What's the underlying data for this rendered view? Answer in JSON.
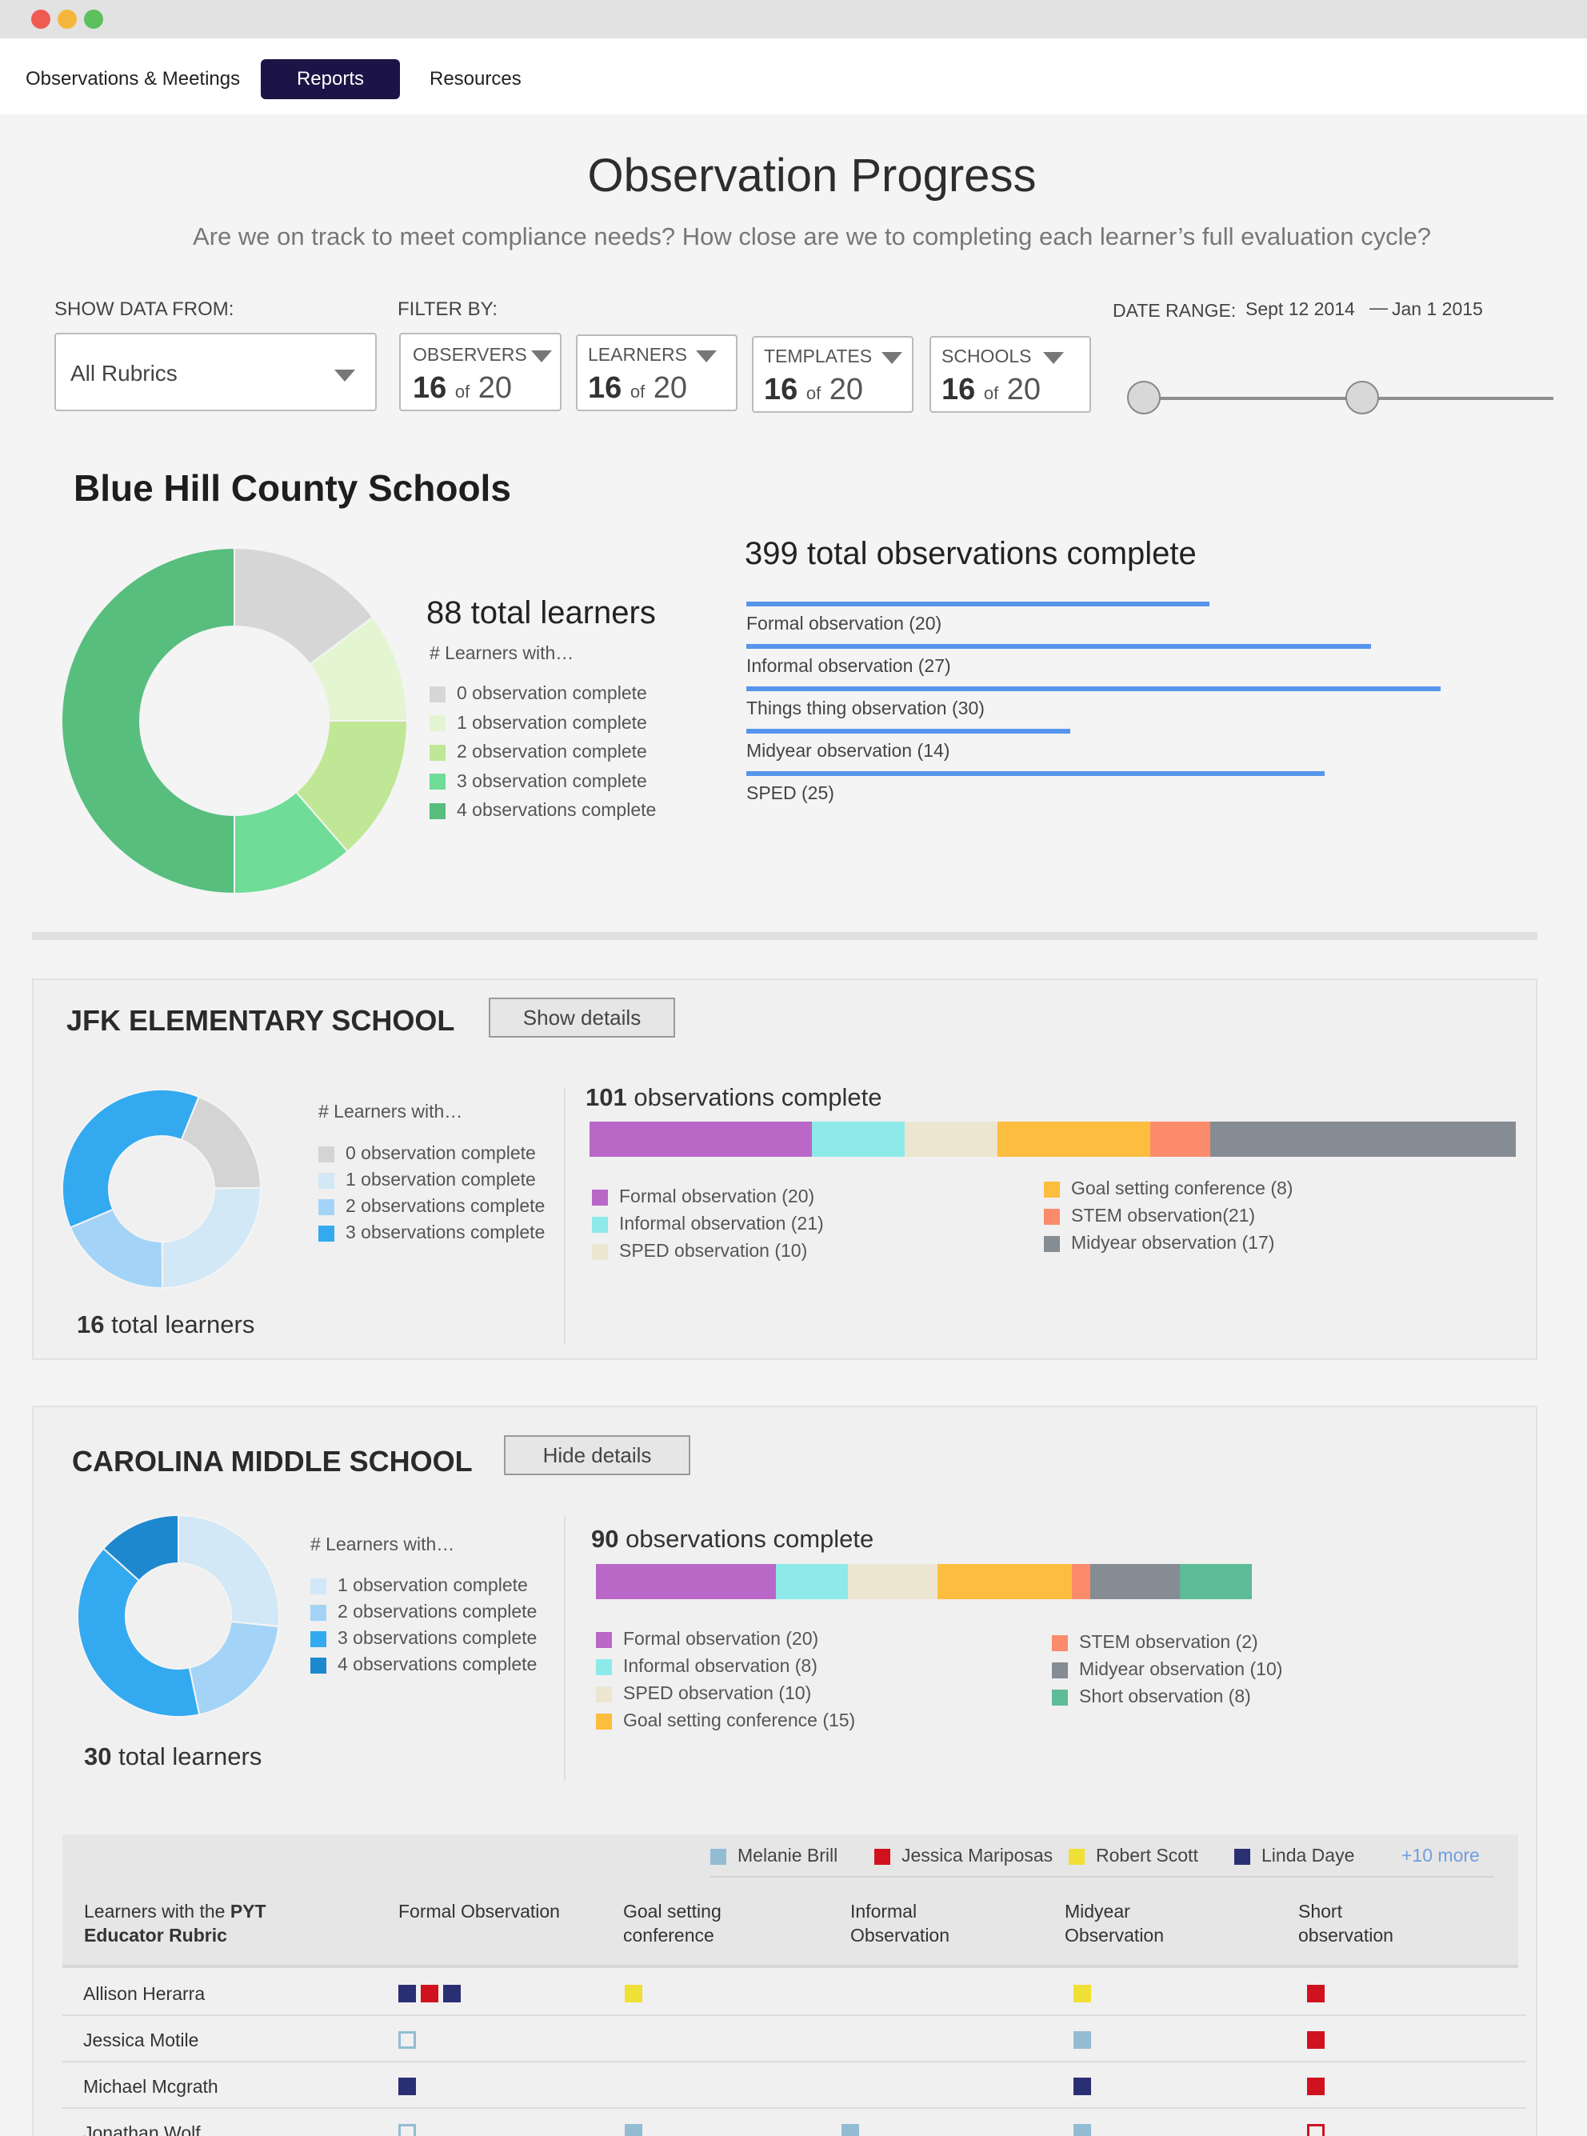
{
  "window": {
    "controls": [
      "close-icon",
      "minimize-icon",
      "zoom-icon"
    ],
    "control_colors": [
      "#ef5a52",
      "#f5b73b",
      "#5cc05f"
    ]
  },
  "nav": {
    "items": [
      "Observations & Meetings",
      "Reports",
      "Resources"
    ],
    "active": "Reports"
  },
  "page": {
    "title": "Observation Progress",
    "subtitle": "Are we on track to meet compliance needs? How close are we to completing each learner’s full evaluation cycle?"
  },
  "filters": {
    "show_label": "SHOW DATA FROM:",
    "rubric_value": "All Rubrics",
    "filter_label": "FILTER BY:",
    "observers": {
      "label": "OBSERVERS",
      "selected": "16",
      "of": "of",
      "total": "20"
    },
    "learners": {
      "label": "LEARNERS",
      "selected": "16",
      "of": "of",
      "total": "20"
    },
    "templates": {
      "label": "TEMPLATES",
      "selected": "16",
      "of": "of",
      "total": "20"
    },
    "schools": {
      "label": "SCHOOLS",
      "selected": "16",
      "of": "of",
      "total": "20"
    },
    "date_label": "DATE RANGE:",
    "date_start": "Sept 12 2014",
    "date_sep": "—",
    "date_end": "Jan 1 2015",
    "range_start_fraction": 0,
    "range_end_fraction": 0.55
  },
  "district": {
    "name": "Blue Hill County Schools",
    "learners_total": "88 total learners",
    "learners_caption": "# Learners with…",
    "observations_total": "399 total observations complete"
  },
  "jfk": {
    "name": "JFK ELEMENTARY SCHOOL",
    "button": "Show details",
    "caption": "# Learners with…",
    "learners_count": "16",
    "learners_suffix": "total learners",
    "obs_count": "101",
    "obs_suffix": "observations complete"
  },
  "carolina": {
    "name": "CAROLINA MIDDLE SCHOOL",
    "button": "Hide details",
    "caption": "# Learners with…",
    "learners_count": "30",
    "learners_suffix": "total learners",
    "obs_count": "90",
    "obs_suffix": "observations complete"
  },
  "table": {
    "observers": [
      {
        "name": "Melanie Brill",
        "color": "#93bcd3"
      },
      {
        "name": "Jessica Mariposas",
        "color": "#d0121f"
      },
      {
        "name": "Robert Scott",
        "color": "#f0e035"
      },
      {
        "name": "Linda Daye",
        "color": "#2a2f74"
      }
    ],
    "more": "+10 more",
    "learner_col_prefix": "Learners with the ",
    "learner_col_bold": "PYT",
    "learner_col_line2": "Educator Rubric",
    "columns": [
      [
        "Formal Observation",
        ""
      ],
      [
        "Goal setting",
        "conference"
      ],
      [
        "Informal",
        "Observation"
      ],
      [
        "Midyear",
        "Observation"
      ],
      [
        "Short",
        "observation"
      ]
    ],
    "rows": [
      "Allison Herarra",
      "Jessica Motile",
      "Michael Mcgrath",
      "Jonathan Wolf"
    ]
  },
  "chart_data": [
    {
      "type": "pie",
      "chart": "district-learners-donut",
      "labels": [
        "0 observation complete",
        "1 observation complete",
        "2 observation complete",
        "3 observation complete",
        "4 observations complete"
      ],
      "values": [
        13,
        9,
        12,
        10,
        44
      ],
      "colors": [
        "#d6d6d6",
        "#e4f5d2",
        "#c0e795",
        "#6fdc98",
        "#57be7e"
      ]
    },
    {
      "type": "bar",
      "chart": "district-observation-bars",
      "categories": [
        "Formal observation (20)",
        "Informal observation (27)",
        "Things thing observation (30)",
        "Midyear observation (14)",
        "SPED (25)"
      ],
      "values": [
        20,
        27,
        30,
        14,
        25
      ],
      "color": "#5795ec"
    },
    {
      "type": "pie",
      "chart": "jfk-learners-donut",
      "labels": [
        "0 observation complete",
        "1 observation complete",
        "2 observations complete",
        "3 observations complete"
      ],
      "values": [
        3,
        4,
        3,
        6
      ],
      "colors": [
        "#d4d4d4",
        "#d3e8f6",
        "#a3d4f7",
        "#33aaf0"
      ]
    },
    {
      "type": "bar",
      "chart": "jfk-observation-stack",
      "categories": [
        "Formal observation (20)",
        "Informal observation (21)",
        "SPED observation (10)",
        "Goal setting conference (8)",
        "STEM observation(21)",
        "Midyear observation (17)"
      ],
      "values": [
        20,
        21,
        10,
        8,
        21,
        17
      ],
      "segments": [
        24,
        10,
        10,
        16.5,
        6.5,
        33
      ],
      "segment_colors": [
        "#b968c7",
        "#8eeae8",
        "#ece6d1",
        "#fdbd3e",
        "#fb8b6b",
        "#858c94"
      ],
      "legend_order": [
        0,
        1,
        2,
        3,
        4,
        5
      ]
    },
    {
      "type": "pie",
      "chart": "carolina-learners-donut",
      "labels": [
        "1 observation complete",
        "2 observations complete",
        "3 observations complete",
        "4 observations complete"
      ],
      "values": [
        8,
        6,
        12,
        4
      ],
      "colors": [
        "#d3e8f6",
        "#a3d4f7",
        "#33aaf0",
        "#1e88ce"
      ]
    },
    {
      "type": "bar",
      "chart": "carolina-observation-stack",
      "categories": [
        "Formal observation (20)",
        "Informal observation (8)",
        "SPED observation (10)",
        "Goal setting conference (15)",
        "STEM observation (2)",
        "Midyear observation (10)",
        "Short observation (8)"
      ],
      "values": [
        20,
        8,
        10,
        15,
        2,
        10,
        8
      ],
      "segment_colors": [
        "#b968c7",
        "#8eeae8",
        "#ece6d1",
        "#fdbd3e",
        "#fb8b6b",
        "#858c94",
        "#5ebb97"
      ]
    }
  ],
  "grid": {
    "rows": [
      [
        [
          [
            "f",
            "#2a2f74"
          ],
          [
            "f",
            "#d0121f"
          ],
          [
            "f",
            "#2a2f74"
          ]
        ],
        [
          [
            "f",
            "#f0e035"
          ]
        ],
        [],
        [
          [
            "f",
            "#f0e035"
          ]
        ],
        [
          [
            "f",
            "#d0121f"
          ]
        ]
      ],
      [
        [
          [
            "o",
            "#93bcd3"
          ]
        ],
        [],
        [],
        [
          [
            "f",
            "#93bcd3"
          ]
        ],
        [
          [
            "f",
            "#d0121f"
          ]
        ]
      ],
      [
        [
          [
            "f",
            "#2a2f74"
          ]
        ],
        [],
        [],
        [
          [
            "f",
            "#2a2f74"
          ]
        ],
        [
          [
            "f",
            "#d0121f"
          ]
        ]
      ],
      [
        [
          [
            "o",
            "#93bcd3"
          ]
        ],
        [
          [
            "f",
            "#93bcd3"
          ]
        ],
        [
          [
            "f",
            "#93bcd3"
          ]
        ],
        [
          [
            "f",
            "#93bcd3"
          ]
        ],
        [
          [
            "o",
            "#d0121f"
          ]
        ]
      ]
    ]
  }
}
